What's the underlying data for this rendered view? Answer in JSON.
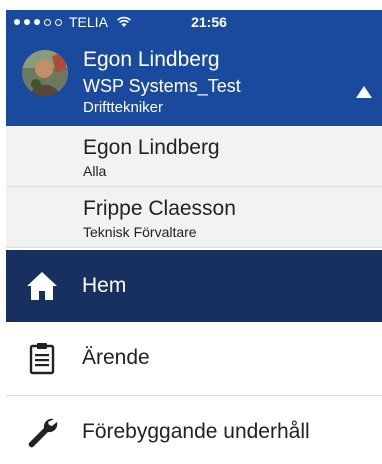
{
  "status_bar": {
    "carrier": "TELIA",
    "time": "21:56"
  },
  "profile": {
    "name": "Egon Lindberg",
    "company": "WSP Systems_Test",
    "role": "Drifttekniker"
  },
  "accounts": [
    {
      "name": "Egon Lindberg",
      "subtitle": "Alla"
    },
    {
      "name": "Frippe Claesson",
      "subtitle": "Teknisk Förvaltare"
    }
  ],
  "nav": {
    "items": [
      {
        "label": "Hem",
        "icon": "home-icon",
        "active": true
      },
      {
        "label": "Ärende",
        "icon": "clipboard-icon",
        "active": false
      },
      {
        "label": "Förebyggande underhåll",
        "icon": "wrench-icon",
        "active": false
      }
    ]
  },
  "colors": {
    "header_bg": "#1a4a9e",
    "active_nav_bg": "#17305f",
    "account_bg": "#f2f2f2"
  }
}
